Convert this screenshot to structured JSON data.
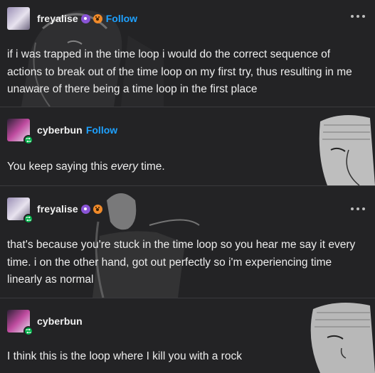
{
  "posts": [
    {
      "username": "freyalise",
      "follow_label": "Follow",
      "text": "if i was trapped in the time loop i would do the correct sequence of actions to break out of the time loop on my first try, thus resulting in me unaware of there being a time loop in the first place"
    },
    {
      "username": "cyberbun",
      "follow_label": "Follow",
      "text_before": "You keep saying this ",
      "text_em": "every",
      "text_after": " time."
    },
    {
      "username": "freyalise",
      "text": "that's because you're stuck in the time loop so you hear me say it every time. i on the other hand, got out perfectly so i'm experiencing time linearly as normal"
    },
    {
      "username": "cyberbun",
      "text": "I think this is the loop where I kill you with a rock"
    }
  ],
  "icons": {
    "more": "more-options-icon",
    "reblog": "reblog-badge-icon"
  },
  "colors": {
    "background": "#232325",
    "follow": "#1ea1ff",
    "reblog_badge": "#00b34a"
  }
}
